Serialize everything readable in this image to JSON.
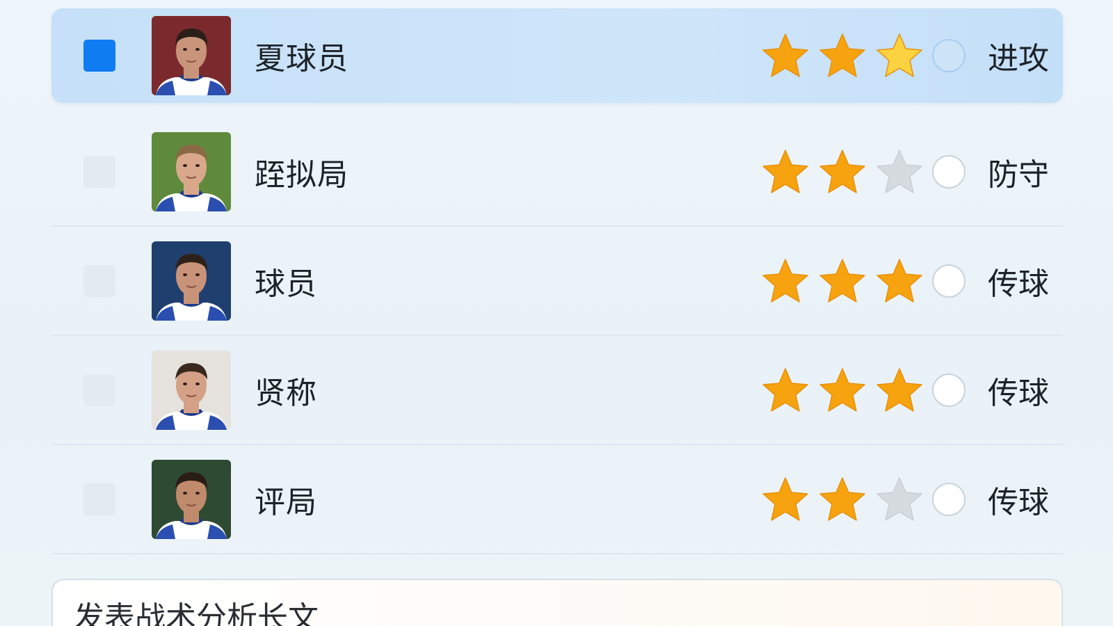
{
  "players": [
    {
      "name": "夏球员",
      "role": "进攻",
      "rating": 3,
      "selected": true,
      "bg": "#7a2a2c",
      "skin": "#c8957a",
      "hair": "#2b1d18"
    },
    {
      "name": "跮拟局",
      "role": "防守",
      "rating": 2,
      "selected": false,
      "bg": "#5f8a3c",
      "skin": "#d9a88a",
      "hair": "#8a6a45"
    },
    {
      "name": "球员",
      "role": "传球",
      "rating": 3,
      "selected": false,
      "bg": "#1f3f6e",
      "skin": "#c89378",
      "hair": "#2e2119"
    },
    {
      "name": "贤称",
      "role": "传球",
      "rating": 3,
      "selected": false,
      "bg": "#e6e3df",
      "skin": "#d4a187",
      "hair": "#3a2a1e"
    },
    {
      "name": "评局",
      "role": "传球",
      "rating": 2,
      "selected": false,
      "bg": "#2e4a33",
      "skin": "#c08a6c",
      "hair": "#2a1d16"
    }
  ],
  "max_rating": 3,
  "colors": {
    "star_on": "#f7a20f",
    "star_on_light": "#fdd240",
    "star_off": "#d6dbe0",
    "accent": "#0f7cf2"
  },
  "composer": {
    "text": "发表战术分析长文"
  }
}
